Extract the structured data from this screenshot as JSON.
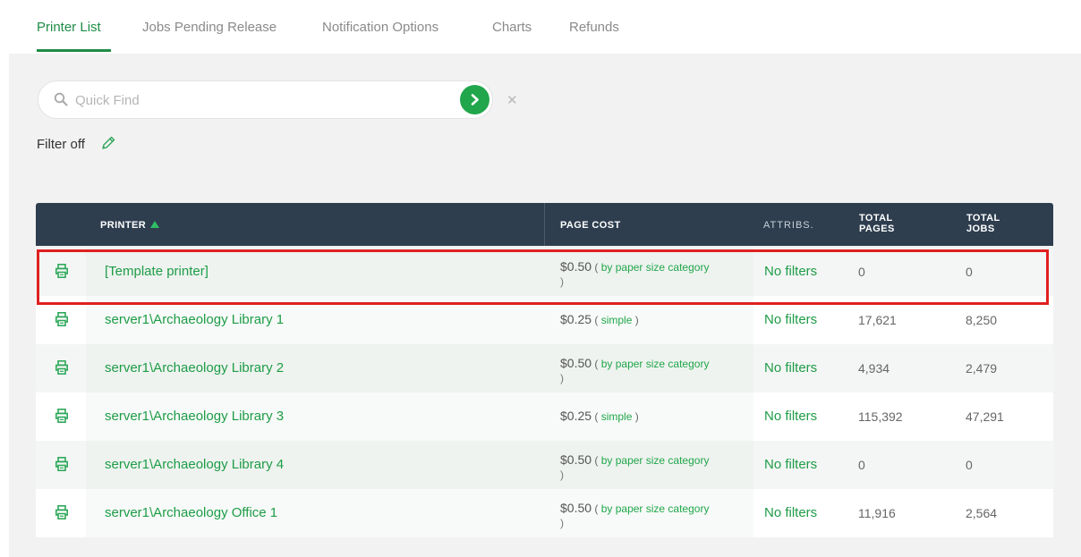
{
  "tabs": [
    {
      "label": "Printer List",
      "active": true
    },
    {
      "label": "Jobs Pending Release",
      "active": false
    },
    {
      "label": "Notification Options",
      "active": false
    },
    {
      "label": "Charts",
      "active": false
    },
    {
      "label": "Refunds",
      "active": false
    }
  ],
  "search": {
    "placeholder": "Quick Find",
    "value": ""
  },
  "filter": {
    "label": "Filter off"
  },
  "table": {
    "columns": {
      "printer": "PRINTER",
      "page_cost": "PAGE COST",
      "attribs": "ATTRIBS.",
      "total_pages": [
        "TOTAL",
        "PAGES"
      ],
      "total_jobs": [
        "TOTAL",
        "JOBS"
      ]
    },
    "rows": [
      {
        "name": "[Template printer]",
        "price": "$0.50",
        "mode": "by paper size category",
        "wrapped": true,
        "attribs": "No filters",
        "pages": "0",
        "jobs": "0"
      },
      {
        "name": "server1\\Archaeology Library 1",
        "price": "$0.25",
        "mode": "simple",
        "wrapped": false,
        "attribs": "No filters",
        "pages": "17,621",
        "jobs": "8,250"
      },
      {
        "name": "server1\\Archaeology Library 2",
        "price": "$0.50",
        "mode": "by paper size category",
        "wrapped": true,
        "attribs": "No filters",
        "pages": "4,934",
        "jobs": "2,479"
      },
      {
        "name": "server1\\Archaeology Library 3",
        "price": "$0.25",
        "mode": "simple",
        "wrapped": false,
        "attribs": "No filters",
        "pages": "115,392",
        "jobs": "47,291"
      },
      {
        "name": "server1\\Archaeology Library 4",
        "price": "$0.50",
        "mode": "by paper size category",
        "wrapped": true,
        "attribs": "No filters",
        "pages": "0",
        "jobs": "0"
      },
      {
        "name": "server1\\Archaeology Office 1",
        "price": "$0.50",
        "mode": "by paper size category",
        "wrapped": true,
        "attribs": "No filters",
        "pages": "11,916",
        "jobs": "2,564"
      }
    ]
  },
  "colors": {
    "accent_green": "#21a64b",
    "header_bg": "#2e3e4f",
    "highlight_red": "#e02020"
  },
  "icons": {
    "search": "search-icon",
    "go": "arrow-right-icon",
    "clear": "close-icon",
    "filter": "pencil-icon",
    "printer": "printer-icon"
  }
}
